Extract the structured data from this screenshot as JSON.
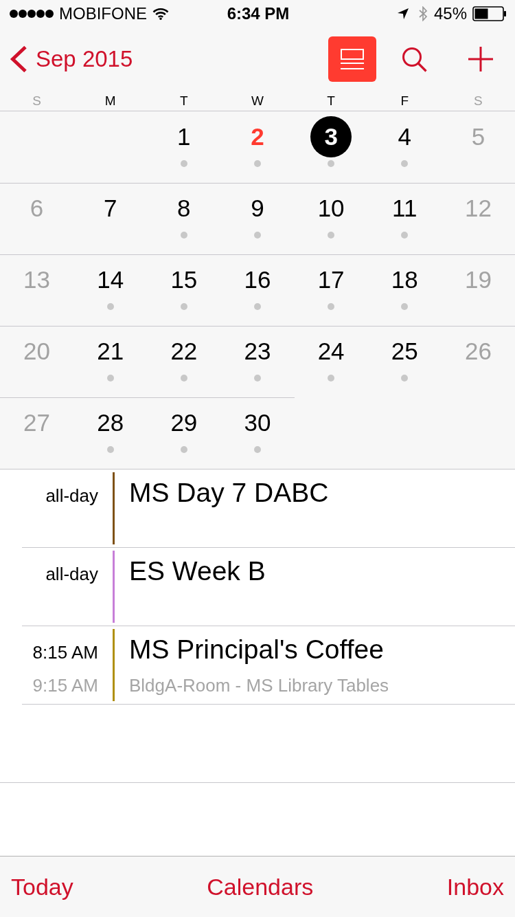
{
  "status_bar": {
    "carrier": "MOBIFONE",
    "time": "6:34 PM",
    "battery": "45%"
  },
  "nav": {
    "back_label": "Sep 2015",
    "list_toggle": {
      "selected": true
    }
  },
  "weekdays": [
    {
      "label": "S",
      "weekend": true
    },
    {
      "label": "M",
      "weekend": false
    },
    {
      "label": "T",
      "weekend": false
    },
    {
      "label": "W",
      "weekend": false
    },
    {
      "label": "T",
      "weekend": false
    },
    {
      "label": "F",
      "weekend": false
    },
    {
      "label": "S",
      "weekend": true
    }
  ],
  "weeks": [
    {
      "days": [
        {
          "kind": "blank"
        },
        {
          "kind": "blank"
        },
        {
          "kind": "day",
          "label": "1",
          "weekend": false,
          "today": false,
          "selected": false,
          "has_events": true
        },
        {
          "kind": "day",
          "label": "2",
          "weekend": false,
          "today": true,
          "selected": false,
          "has_events": true
        },
        {
          "kind": "day",
          "label": "3",
          "weekend": false,
          "today": false,
          "selected": true,
          "has_events": true
        },
        {
          "kind": "day",
          "label": "4",
          "weekend": false,
          "today": false,
          "selected": false,
          "has_events": true
        },
        {
          "kind": "day",
          "label": "5",
          "weekend": true,
          "today": false,
          "selected": false,
          "has_events": false
        }
      ]
    },
    {
      "days": [
        {
          "kind": "day",
          "label": "6",
          "weekend": true,
          "today": false,
          "selected": false,
          "has_events": false
        },
        {
          "kind": "day",
          "label": "7",
          "weekend": false,
          "today": false,
          "selected": false,
          "has_events": false
        },
        {
          "kind": "day",
          "label": "8",
          "weekend": false,
          "today": false,
          "selected": false,
          "has_events": true
        },
        {
          "kind": "day",
          "label": "9",
          "weekend": false,
          "today": false,
          "selected": false,
          "has_events": true
        },
        {
          "kind": "day",
          "label": "10",
          "weekend": false,
          "today": false,
          "selected": false,
          "has_events": true
        },
        {
          "kind": "day",
          "label": "11",
          "weekend": false,
          "today": false,
          "selected": false,
          "has_events": true
        },
        {
          "kind": "day",
          "label": "12",
          "weekend": true,
          "today": false,
          "selected": false,
          "has_events": false
        }
      ]
    },
    {
      "days": [
        {
          "kind": "day",
          "label": "13",
          "weekend": true,
          "today": false,
          "selected": false,
          "has_events": false
        },
        {
          "kind": "day",
          "label": "14",
          "weekend": false,
          "today": false,
          "selected": false,
          "has_events": true
        },
        {
          "kind": "day",
          "label": "15",
          "weekend": false,
          "today": false,
          "selected": false,
          "has_events": true
        },
        {
          "kind": "day",
          "label": "16",
          "weekend": false,
          "today": false,
          "selected": false,
          "has_events": true
        },
        {
          "kind": "day",
          "label": "17",
          "weekend": false,
          "today": false,
          "selected": false,
          "has_events": true
        },
        {
          "kind": "day",
          "label": "18",
          "weekend": false,
          "today": false,
          "selected": false,
          "has_events": true
        },
        {
          "kind": "day",
          "label": "19",
          "weekend": true,
          "today": false,
          "selected": false,
          "has_events": false
        }
      ]
    },
    {
      "days": [
        {
          "kind": "day",
          "label": "20",
          "weekend": true,
          "today": false,
          "selected": false,
          "has_events": false
        },
        {
          "kind": "day",
          "label": "21",
          "weekend": false,
          "today": false,
          "selected": false,
          "has_events": true
        },
        {
          "kind": "day",
          "label": "22",
          "weekend": false,
          "today": false,
          "selected": false,
          "has_events": true
        },
        {
          "kind": "day",
          "label": "23",
          "weekend": false,
          "today": false,
          "selected": false,
          "has_events": true
        },
        {
          "kind": "day",
          "label": "24",
          "weekend": false,
          "today": false,
          "selected": false,
          "has_events": true
        },
        {
          "kind": "day",
          "label": "25",
          "weekend": false,
          "today": false,
          "selected": false,
          "has_events": true
        },
        {
          "kind": "day",
          "label": "26",
          "weekend": true,
          "today": false,
          "selected": false,
          "has_events": false
        }
      ]
    },
    {
      "days": [
        {
          "kind": "day",
          "label": "27",
          "weekend": true,
          "today": false,
          "selected": false,
          "has_events": false
        },
        {
          "kind": "day",
          "label": "28",
          "weekend": false,
          "today": false,
          "selected": false,
          "has_events": true
        },
        {
          "kind": "day",
          "label": "29",
          "weekend": false,
          "today": false,
          "selected": false,
          "has_events": true
        },
        {
          "kind": "day",
          "label": "30",
          "weekend": false,
          "today": false,
          "selected": false,
          "has_events": true
        }
      ]
    }
  ],
  "events": [
    {
      "times": [
        "all-day"
      ],
      "title": "MS Day 7 DABC",
      "color": "#7f5217"
    },
    {
      "times": [
        "all-day"
      ],
      "title": "ES Week B",
      "color": "#c77fd8"
    },
    {
      "times": [
        "8:15 AM",
        "9:15 AM"
      ],
      "title": "MS Principal's Coffee",
      "location": "BldgA-Room - MS Library Tables",
      "color": "#b0900f"
    }
  ],
  "tab_bar": {
    "items": [
      "Today",
      "Calendars",
      "Inbox"
    ]
  }
}
